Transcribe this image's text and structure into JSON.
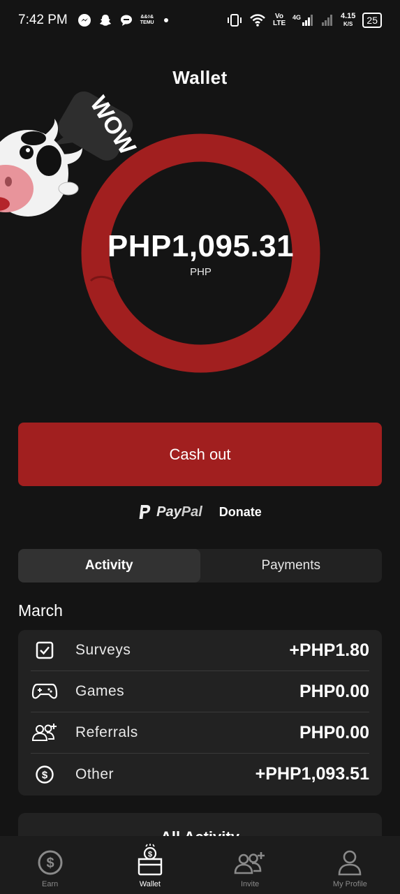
{
  "status_bar": {
    "time": "7:42 PM",
    "left_icons": [
      "messenger-icon",
      "snapchat-icon",
      "chat-icon",
      "temu-icon",
      "dot-icon"
    ],
    "temu_label": "TEMU",
    "right": {
      "volte_label": "Vo LTE",
      "network_label": "4G",
      "speed_value": "4.15",
      "speed_unit": "K/S",
      "battery": "25"
    }
  },
  "header": {
    "title": "Wallet"
  },
  "mascot": {
    "bubble_text": "WOW"
  },
  "balance": {
    "amount": "PHP1,095.31",
    "currency": "PHP"
  },
  "actions": {
    "cashout_label": "Cash out",
    "paypal_pay": "Pay",
    "paypal_pal": "Pal",
    "donate_label": "Donate"
  },
  "tabs": [
    {
      "label": "Activity",
      "active": true
    },
    {
      "label": "Payments",
      "active": false
    }
  ],
  "activity": {
    "month": "March",
    "rows": [
      {
        "icon": "checkbox-icon",
        "label": "Surveys",
        "value": "+PHP1.80"
      },
      {
        "icon": "gamepad-icon",
        "label": "Games",
        "value": "PHP0.00"
      },
      {
        "icon": "referrals-icon",
        "label": "Referrals",
        "value": "PHP0.00"
      },
      {
        "icon": "dollar-circle-icon",
        "label": "Other",
        "value": "+PHP1,093.51"
      }
    ],
    "all_activity_label": "All Activity"
  },
  "bottom_nav": [
    {
      "icon": "dollar-circle-icon",
      "label": "Earn",
      "active": false
    },
    {
      "icon": "wallet-icon",
      "label": "Wallet",
      "active": true
    },
    {
      "icon": "invite-icon",
      "label": "Invite",
      "active": false
    },
    {
      "icon": "person-icon",
      "label": "My Profile",
      "active": false
    }
  ],
  "colors": {
    "background": "#141414",
    "accent": "#a11f1f",
    "card": "#222222"
  }
}
